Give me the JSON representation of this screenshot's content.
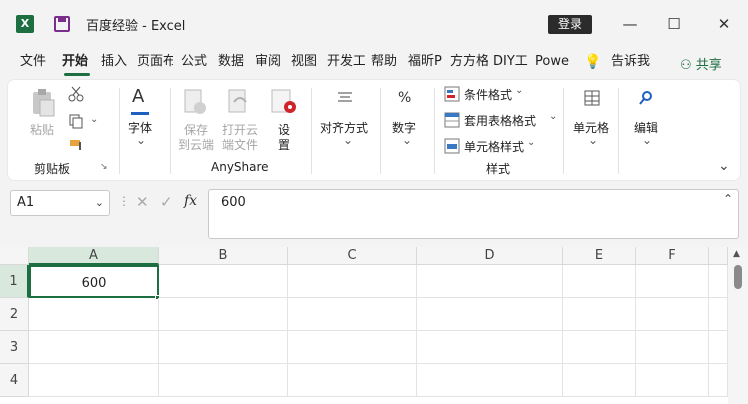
{
  "titlebar": {
    "app_icon": "excel-logo",
    "title": "百度经验  -  Excel",
    "login": "登录",
    "minimize": "—",
    "maximize": "☐",
    "close": "✕"
  },
  "tabs": [
    "文件",
    "开始",
    "插入",
    "页面布",
    "公式",
    "数据",
    "审阅",
    "视图",
    "开发工",
    "帮助",
    "福昕P",
    "方方格",
    "DIY工",
    "Powe",
    "告诉我"
  ],
  "active_tab": "开始",
  "share_label": "共享",
  "ribbon": {
    "paste": "粘贴",
    "clipboard": "剪贴板",
    "font": "字体",
    "save_cloud": [
      "保存",
      "到云端"
    ],
    "open_cloud": [
      "打开云",
      "端文件"
    ],
    "settings": [
      "设",
      "置"
    ],
    "anyshare": "AnyShare",
    "align": "对齐方式",
    "number": "数字",
    "cond_format": "条件格式",
    "table_format": "套用表格格式",
    "cell_style": "单元格样式",
    "styles": "样式",
    "cells": "单元格",
    "editing": "编辑"
  },
  "formula_bar": {
    "name_box": "A1",
    "fx": "fx",
    "value": "600"
  },
  "sheet": {
    "columns": [
      "A",
      "B",
      "C",
      "D",
      "E",
      "F"
    ],
    "rows": [
      "1",
      "2",
      "3",
      "4"
    ],
    "a1": "600"
  },
  "accent": "#1d6f42"
}
